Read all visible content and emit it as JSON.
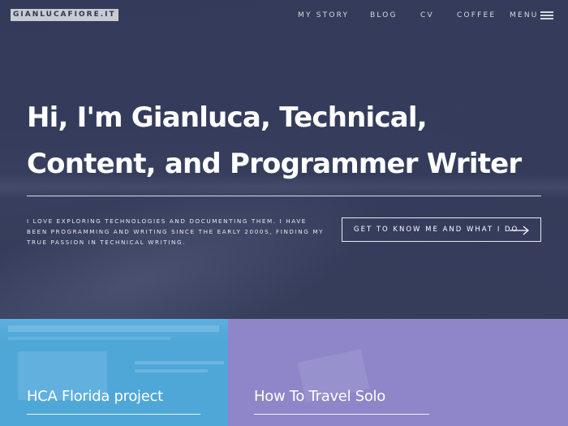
{
  "site": {
    "logo": "GIANLUCAFIORE.IT"
  },
  "nav": {
    "items": [
      {
        "label": "MY STORY"
      },
      {
        "label": "BLOG"
      },
      {
        "label": "CV"
      },
      {
        "label": "COFFEE"
      }
    ],
    "menu_label": "MENU",
    "menu_icon": "hamburger-icon"
  },
  "hero": {
    "headline": "Hi, I'm Gianluca, Technical, Content, and Programmer Writer",
    "intro": "I love exploring technologies and documenting them. I have been programming and writing since the early 2000s, finding my true passion in technical writing.",
    "cta_label": "GET TO KNOW ME AND WHAT I DO",
    "cta_icon": "arrow-right-icon"
  },
  "cards": [
    {
      "title": "HCA Florida project",
      "color": "#4fa7d8"
    },
    {
      "title": "How To Travel Solo",
      "color": "#8e86c8"
    }
  ],
  "colors": {
    "hero_overlay": "#343b5a",
    "text": "#ffffff"
  }
}
